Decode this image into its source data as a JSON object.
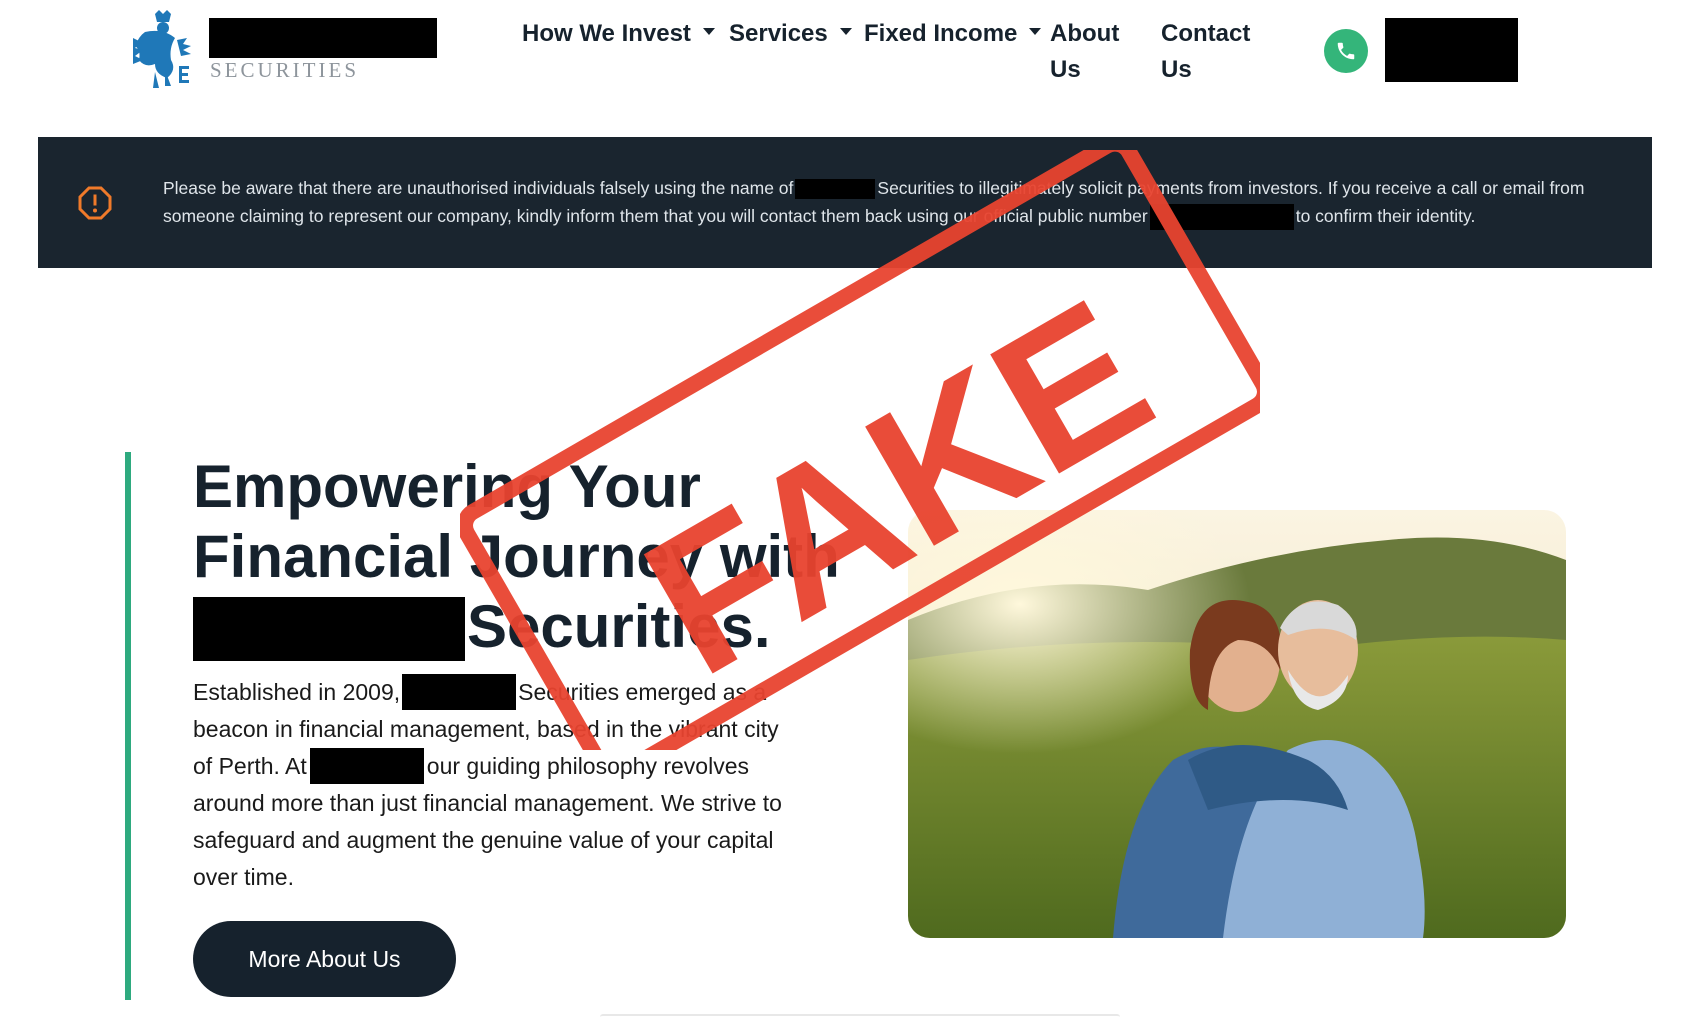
{
  "header": {
    "brand_subtitle": "SECURITIES",
    "nav": [
      {
        "label": "How We Invest"
      },
      {
        "label": "Services"
      },
      {
        "label": "Fixed Income"
      },
      {
        "label": "About",
        "label2": "Us"
      },
      {
        "label": "Contact",
        "label2": "Us"
      }
    ]
  },
  "alert": {
    "part1": "Please be aware that there are unauthorised individuals falsely using the name of",
    "part2": "Securities to illegitimately solicit payments from investors. If you receive a call or email from someone claiming to represent our company, kindly inform them that you will contact them back using our official public number",
    "part3": "to confirm their identity."
  },
  "hero": {
    "headline_line1": "Empowering Your",
    "headline_line2": "Financial Journey with",
    "headline_line3_suffix": "Securities.",
    "desc_part1": "Established in 2009,",
    "desc_part2": "Securities emerged as a beacon in financial management, based in the vibrant city of Perth. At",
    "desc_part3": "our guiding philosophy revolves around more than just financial management. We strive to safeguard and augment the genuine value of your capital over time.",
    "button_label": "More About Us"
  },
  "stamp": {
    "text": "FAKE"
  },
  "colors": {
    "alert_bg": "#1a252f",
    "accent_green": "#2eaa7f",
    "stamp_red": "#e8432f",
    "dark_navy": "#16222d"
  }
}
